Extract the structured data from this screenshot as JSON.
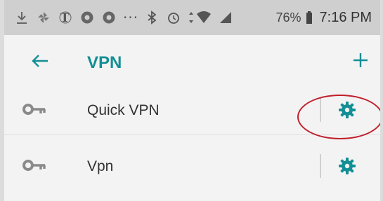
{
  "status_bar": {
    "icons": [
      "download-icon",
      "pinwheel-icon",
      "newspaper-icon",
      "chrome-icon",
      "chrome-icon-2",
      "more-dots-icon",
      "bluetooth-icon",
      "alarm-icon",
      "data-arrows-icon",
      "wifi-icon",
      "signal-icon"
    ],
    "overflow_dots": "···",
    "battery": "76%",
    "time": "7:16 PM"
  },
  "app_bar": {
    "back_icon": "arrow-left-icon",
    "title": "VPN",
    "add_icon": "plus-icon"
  },
  "vpn_list": [
    {
      "name": "Quick VPN",
      "icon": "key-icon",
      "action_icon": "gear-icon"
    },
    {
      "name": "Vpn",
      "icon": "key-icon",
      "action_icon": "gear-icon"
    }
  ],
  "colors": {
    "accent": "#138f95",
    "status_bar_bg": "#cfcfcf",
    "background": "#f3f3f3",
    "highlight_circle": "#c21f2b",
    "icon_gray": "#8a8a8a"
  }
}
